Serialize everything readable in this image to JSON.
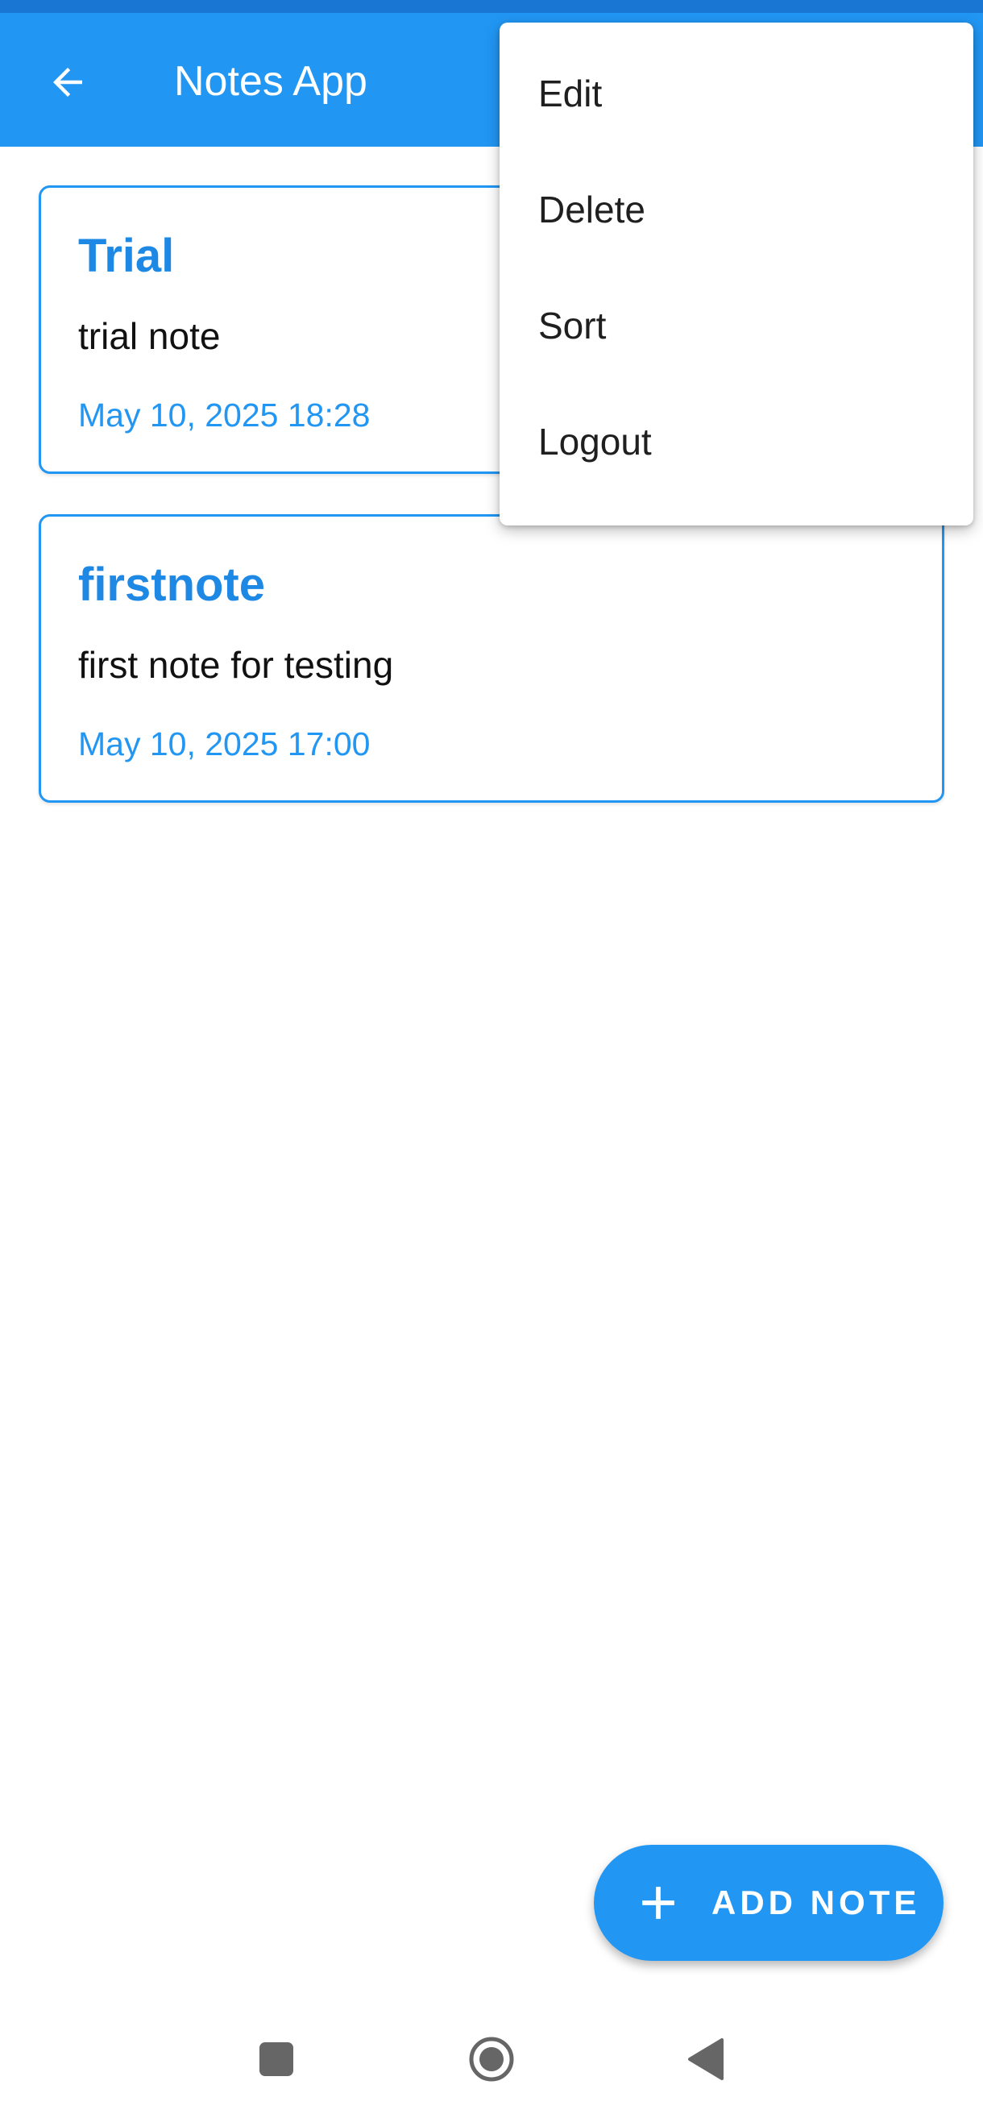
{
  "app": {
    "title": "Notes App",
    "colors": {
      "primary": "#2196F3",
      "primary_dark": "#1976D2",
      "on_primary": "#ffffff"
    }
  },
  "toolbar": {
    "back_icon": "arrow-left-icon"
  },
  "overflow_menu": {
    "items": [
      {
        "label": "Edit"
      },
      {
        "label": "Delete"
      },
      {
        "label": "Sort"
      },
      {
        "label": "Logout"
      }
    ]
  },
  "notes": [
    {
      "title": "Trial",
      "body": "trial note",
      "date": "May 10, 2025 18:28"
    },
    {
      "title": "firstnote",
      "body": "first note for testing",
      "date": "May 10, 2025 17:00"
    }
  ],
  "fab": {
    "label": "ADD NOTE",
    "icon": "plus-icon"
  },
  "system_nav": {
    "icons": [
      "recents-square-icon",
      "home-circle-icon",
      "back-triangle-icon"
    ]
  }
}
